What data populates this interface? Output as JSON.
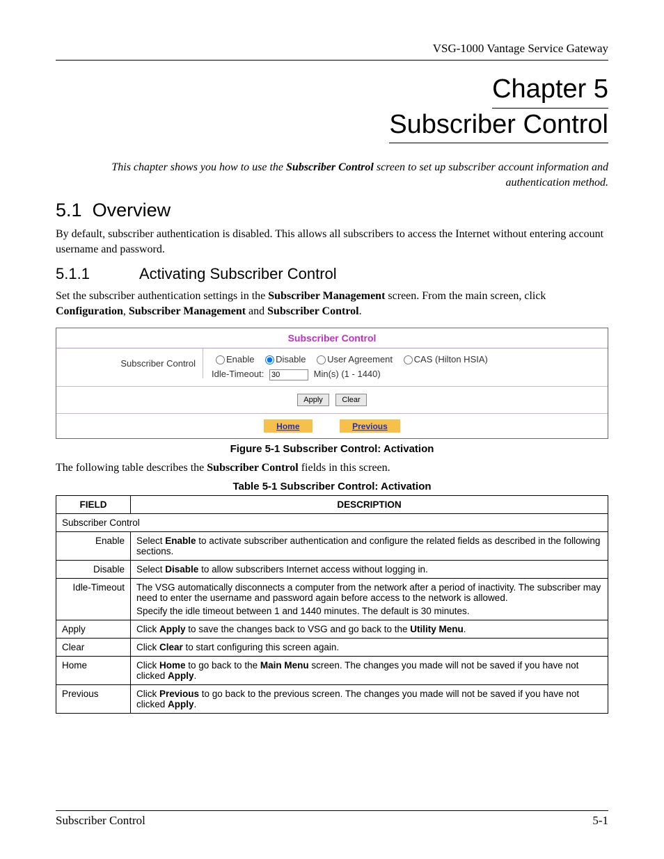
{
  "header": {
    "product": "VSG-1000 Vantage Service Gateway"
  },
  "chapter": {
    "line1": "Chapter 5",
    "line2": "Subscriber Control"
  },
  "intro": {
    "prefix": "This chapter shows you how to use the ",
    "bold": "Subscriber Control",
    "suffix": " screen to set up subscriber account information and authentication method."
  },
  "sections": {
    "s1": {
      "num": "5.1",
      "title": "Overview",
      "body": "By default, subscriber authentication is disabled. This allows all subscribers to access the Internet without entering account username and password."
    },
    "s11": {
      "num": "5.1.1",
      "title": "Activating Subscriber Control",
      "body_pre": "Set the subscriber authentication settings in the ",
      "b1": "Subscriber Management",
      "mid1": " screen. From the main screen, click ",
      "b2": "Configuration",
      "mid2": ", ",
      "b3": "Subscriber Management",
      "mid3": " and ",
      "b4": "Subscriber Control",
      "end": "."
    }
  },
  "figure": {
    "panel_title": "Subscriber Control",
    "row_label": "Subscriber Control",
    "options": {
      "enable": "Enable",
      "disable": "Disable",
      "agreement": "User Agreement",
      "cas": "CAS (Hilton HSIA)"
    },
    "timeout_label": "Idle-Timeout:",
    "timeout_value": "30",
    "timeout_units": "Min(s) (1 - 1440)",
    "buttons": {
      "apply": "Apply",
      "clear": "Clear"
    },
    "links": {
      "home": "Home",
      "previous": "Previous"
    },
    "caption": "Figure 5-1 Subscriber Control: Activation"
  },
  "table_intro": {
    "pre": "The following table describes the ",
    "b": "Subscriber Control",
    "post": " fields in this screen."
  },
  "table": {
    "caption": "Table 5-1 Subscriber Control: Activation",
    "headers": {
      "field": "FIELD",
      "desc": "DESCRIPTION"
    },
    "span_row": "Subscriber Control",
    "rows": {
      "enable": {
        "field": "Enable",
        "pre": "Select ",
        "b1": "Enable",
        "post": " to activate subscriber authentication and configure the related fields as described in the following sections."
      },
      "disable": {
        "field": "Disable",
        "pre": "Select ",
        "b1": "Disable",
        "post": " to allow subscribers Internet access without logging in."
      },
      "idle": {
        "field": "Idle-Timeout",
        "p1": "The VSG automatically disconnects a computer from the network after a period of inactivity. The subscriber may need to enter the username and password again before access to the network is allowed.",
        "p2": "Specify the idle timeout between 1 and 1440 minutes. The default is 30 minutes."
      },
      "apply": {
        "field": "Apply",
        "pre": "Click ",
        "b1": "Apply",
        "mid": " to save the changes back to VSG and go back to the ",
        "b2": "Utility Menu",
        "post": "."
      },
      "clear": {
        "field": "Clear",
        "pre": "Click ",
        "b1": "Clear",
        "post": " to start configuring this screen again."
      },
      "home": {
        "field": "Home",
        "pre": "Click ",
        "b1": "Home",
        "mid": " to go back to the ",
        "b2": "Main Menu",
        "mid2": " screen. The changes you made will not be saved if you have not clicked ",
        "b3": "Apply",
        "post": "."
      },
      "previous": {
        "field": "Previous",
        "pre": "Click ",
        "b1": "Previous",
        "mid": " to go back to the previous screen. The changes you made will not be saved if you have not clicked ",
        "b2": "Apply",
        "post": "."
      }
    }
  },
  "footer": {
    "left": "Subscriber Control",
    "right": "5-1"
  }
}
